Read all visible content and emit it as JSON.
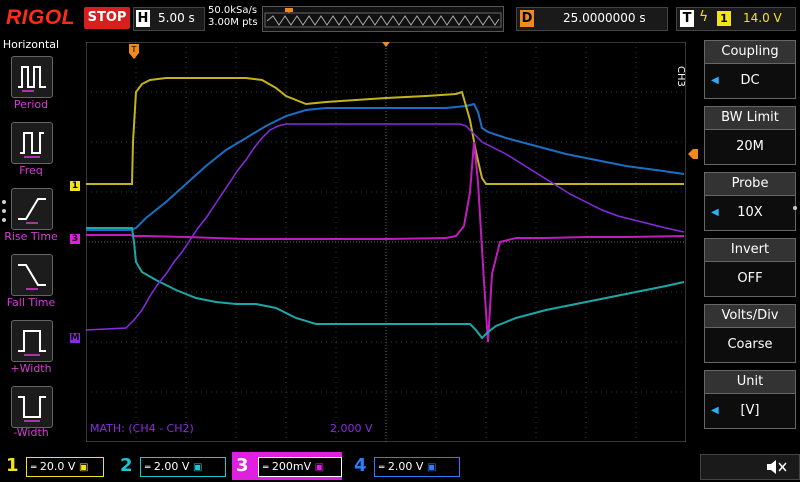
{
  "header": {
    "brand": "RIGOL",
    "run_state": "STOP",
    "timebase_letter": "H",
    "timebase": "5.00 s",
    "sample_rate": "50.0kSa/s",
    "memory_depth": "3.00M pts",
    "delay_letter": "D",
    "delay": "25.0000000 s",
    "trigger_letter": "T",
    "trigger_source": "1",
    "trigger_level": "14.0 V"
  },
  "left_menu": {
    "title": "Horizontal",
    "items": [
      {
        "label": "Period",
        "icon": "period-icon"
      },
      {
        "label": "Freq",
        "icon": "frequency-icon"
      },
      {
        "label": "Rise Time",
        "icon": "rise-time-icon"
      },
      {
        "label": "Fall Time",
        "icon": "fall-time-icon"
      },
      {
        "label": "+Width",
        "icon": "positive-width-icon"
      },
      {
        "label": "-Width",
        "icon": "negative-width-icon"
      }
    ]
  },
  "screen": {
    "math_label": "MATH: (CH4 - CH2)",
    "math_scale": "2.000 V",
    "ch1_marker": "1",
    "ch3_marker": "3",
    "math_marker": "M"
  },
  "right_menu": {
    "channel_tag": "CH3",
    "items": [
      {
        "title": "Coupling",
        "value": "DC"
      },
      {
        "title": "BW Limit",
        "value": "20M"
      },
      {
        "title": "Probe",
        "value": "10X"
      },
      {
        "title": "Invert",
        "value": "OFF"
      },
      {
        "title": "Volts/Div",
        "value": "Coarse"
      },
      {
        "title": "Unit",
        "value": "[V]"
      }
    ]
  },
  "channels": [
    {
      "num": "1",
      "scale": "20.0 V",
      "color": "#f5e31a"
    },
    {
      "num": "2",
      "scale": "2.00 V",
      "color": "#19c8d4"
    },
    {
      "num": "3",
      "scale": "200mV",
      "color": "#e020e0"
    },
    {
      "num": "4",
      "scale": "2.00 V",
      "color": "#2a7fff"
    }
  ],
  "colors": {
    "ch1": "#c4b41a",
    "ch2": "#1ca7a8",
    "ch3": "#c21cc0",
    "ch4": "#1a6fc4",
    "math": "#8a2be2",
    "trigger": "#f08a1e"
  }
}
